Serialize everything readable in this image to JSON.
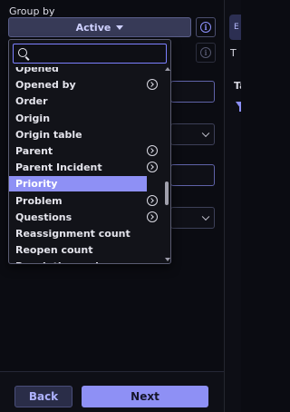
{
  "group_by": {
    "label": "Group by",
    "selected_value": "Active"
  },
  "search": {
    "placeholder": "",
    "value": ""
  },
  "options": [
    {
      "label": "Opened",
      "has_submenu": false,
      "selected": false
    },
    {
      "label": "Opened by",
      "has_submenu": true,
      "selected": false
    },
    {
      "label": "Order",
      "has_submenu": false,
      "selected": false
    },
    {
      "label": "Origin",
      "has_submenu": false,
      "selected": false
    },
    {
      "label": "Origin table",
      "has_submenu": false,
      "selected": false
    },
    {
      "label": "Parent",
      "has_submenu": true,
      "selected": false
    },
    {
      "label": "Parent Incident",
      "has_submenu": true,
      "selected": false
    },
    {
      "label": "Priority",
      "has_submenu": false,
      "selected": true
    },
    {
      "label": "Problem",
      "has_submenu": true,
      "selected": false
    },
    {
      "label": "Questions",
      "has_submenu": true,
      "selected": false
    },
    {
      "label": "Reassignment count",
      "has_submenu": false,
      "selected": false
    },
    {
      "label": "Reopen count",
      "has_submenu": false,
      "selected": false
    },
    {
      "label": "Resolution code",
      "has_submenu": false,
      "selected": false
    }
  ],
  "right_panel": {
    "tab_fragment": "E",
    "text_fragment": "T",
    "heading_fragment": "Ta"
  },
  "footer": {
    "back_label": "Back",
    "next_label": "Next"
  },
  "colors": {
    "accent": "#8e90f5",
    "background": "#0b0c12",
    "select_bg": "#373a57"
  }
}
